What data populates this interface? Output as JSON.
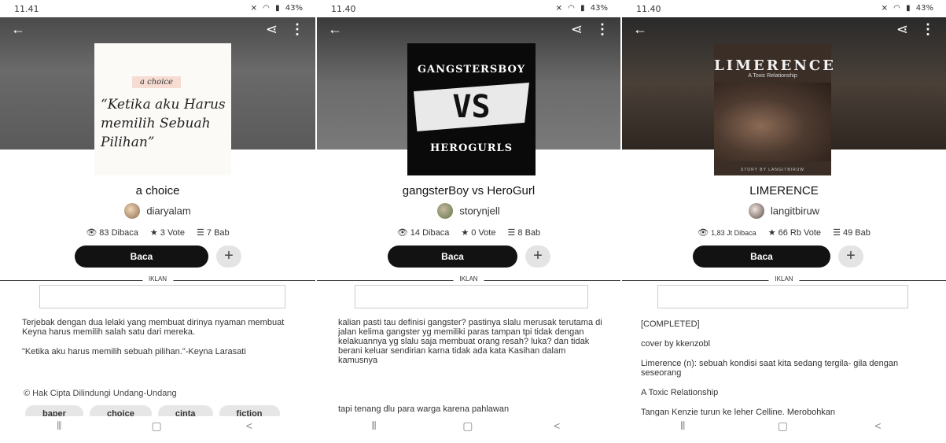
{
  "screens": [
    {
      "status": {
        "time": "11.41",
        "battery": "43%"
      },
      "cover": {
        "badge": "a choice",
        "text": "“Ketika aku Harus memilih Sebuah Pilihan”"
      },
      "title": "a choice",
      "author": "diaryalam",
      "stats": {
        "reads": "83 Dibaca",
        "votes": "3 Vote",
        "parts": "7 Bab"
      },
      "read_label": "Baca",
      "ad_label": "IKLAN",
      "description": [
        "Terjebak dengan dua lelaki yang membuat dirinya nyaman membuat Keyna harus memilih salah satu dari mereka.",
        "\"Ketika aku harus memilih sebuah pilihan.\"-Keyna Larasati"
      ],
      "copyright": "Hak Cipta Dilindungi Undang-Undang",
      "tags": [
        "baper",
        "choice",
        "cinta",
        "fiction"
      ]
    },
    {
      "status": {
        "time": "11.40",
        "battery": "43%"
      },
      "cover": {
        "top": "GANGSTERSBOY",
        "vs": "VS",
        "bottom": "HEROGURLS"
      },
      "title": "gangsterBoy vs HeroGurl",
      "author": "storynjell",
      "stats": {
        "reads": "14 Dibaca",
        "votes": "0 Vote",
        "parts": "8 Bab"
      },
      "read_label": "Baca",
      "ad_label": "IKLAN",
      "description": [
        "kalian pasti tau definisi gangster? pastinya slalu merusak terutama di jalan kelima gangster yg memiliki paras tampan tpi tidak dengan kelakuannya yg slalu saja membuat orang resah? luka? dan tidak berani keluar sendirian karna tidak ada kata Kasihan dalam kamusnya",
        "",
        "tapi tenang dlu para warga karena pahlawan"
      ]
    },
    {
      "status": {
        "time": "11.40",
        "battery": "43%"
      },
      "cover": {
        "title": "LIMERENCE",
        "subtitle": "A Toxic Relationship",
        "credit": "STORY BY LANGITBIRUW"
      },
      "title": "LIMERENCE",
      "author": "langitbiruw",
      "stats": {
        "reads": "1,83 Jt Dibaca",
        "votes": "66 Rb Vote",
        "parts": "49 Bab"
      },
      "read_label": "Baca",
      "ad_label": "IKLAN",
      "description": [
        "[COMPLETED]",
        "cover by kkenzobl",
        "Limerence (n): sebuah kondisi saat kita sedang tergila- gila dengan seseorang",
        "A Toxic Relationship",
        "Tangan Kenzie turun ke leher Celline. Merobohkan"
      ]
    }
  ]
}
